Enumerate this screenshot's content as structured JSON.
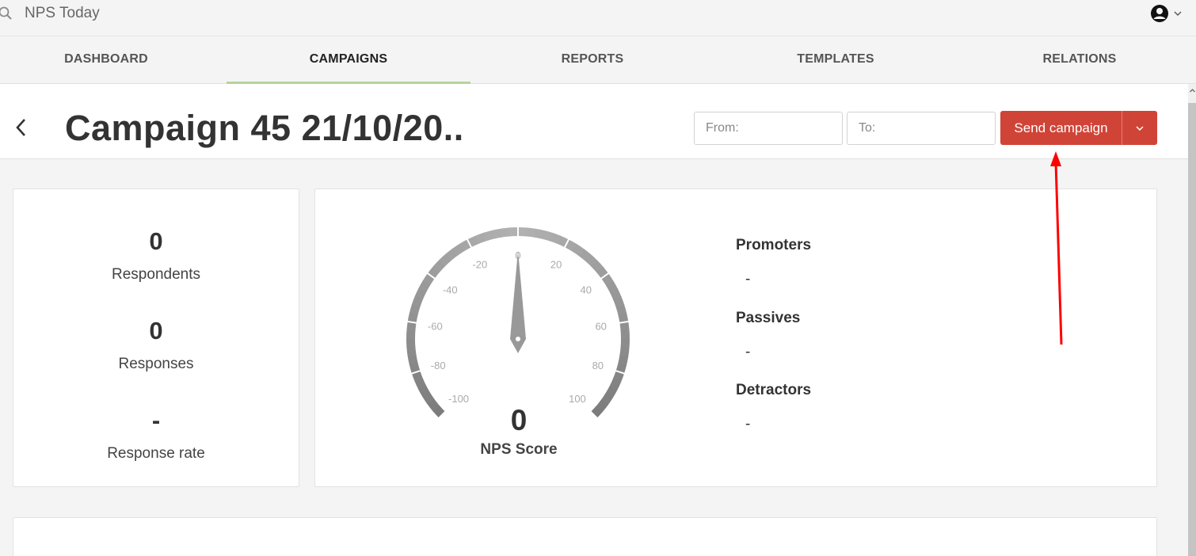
{
  "search": {
    "text": "NPS Today"
  },
  "nav": {
    "tabs": [
      {
        "label": "DASHBOARD"
      },
      {
        "label": "CAMPAIGNS"
      },
      {
        "label": "REPORTS"
      },
      {
        "label": "TEMPLATES"
      },
      {
        "label": "RELATIONS"
      }
    ],
    "active_tab": "CAMPAIGNS"
  },
  "header": {
    "title": "Campaign 45 21/10/20..",
    "from_placeholder": "From:",
    "to_placeholder": "To:",
    "send_label": "Send campaign"
  },
  "stats": {
    "respondents_value": "0",
    "respondents_label": "Respondents",
    "responses_value": "0",
    "responses_label": "Responses",
    "rate_value": "-",
    "rate_label": "Response rate"
  },
  "gauge": {
    "min": -100,
    "max": 100,
    "value": 0,
    "tick_labels": [
      "-100",
      "-80",
      "-60",
      "-40",
      "-20",
      "0",
      "20",
      "40",
      "60",
      "80",
      "100"
    ],
    "score_value": "0",
    "score_label": "NPS Score"
  },
  "segments": [
    {
      "name": "Promoters",
      "value": "-"
    },
    {
      "name": "Passives",
      "value": "-"
    },
    {
      "name": "Detractors",
      "value": "-"
    }
  ],
  "colors": {
    "accent_red": "#d04437",
    "tab_underline": "#b5d49a",
    "annotation_arrow": "#ff0000"
  }
}
